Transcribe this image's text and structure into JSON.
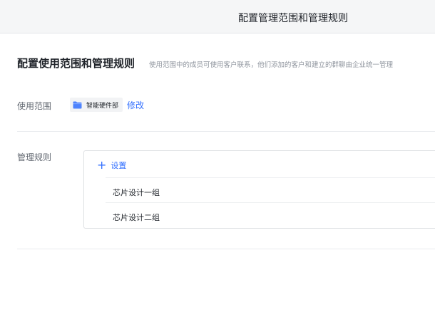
{
  "window": {
    "title": "配置管理范围和管理规则"
  },
  "section": {
    "heading": "配置使用范围和管理规则",
    "description": "使用范围中的成员可使用客户联系，他们添加的客户和建立的群聊由企业统一管理"
  },
  "scope": {
    "label": "使用范围",
    "department": {
      "icon": "folder-icon",
      "name": "智能硬件部"
    },
    "edit_label": "修改"
  },
  "rules": {
    "label": "管理规则",
    "add": {
      "icon": "plus-icon",
      "label": "设置"
    },
    "groups": [
      {
        "name": "芯片设计一组"
      },
      {
        "name": "芯片设计二组"
      }
    ]
  },
  "colors": {
    "accent": "#3370ff",
    "folder": "#4e83fd",
    "titlebar": "#f5f6f7"
  }
}
